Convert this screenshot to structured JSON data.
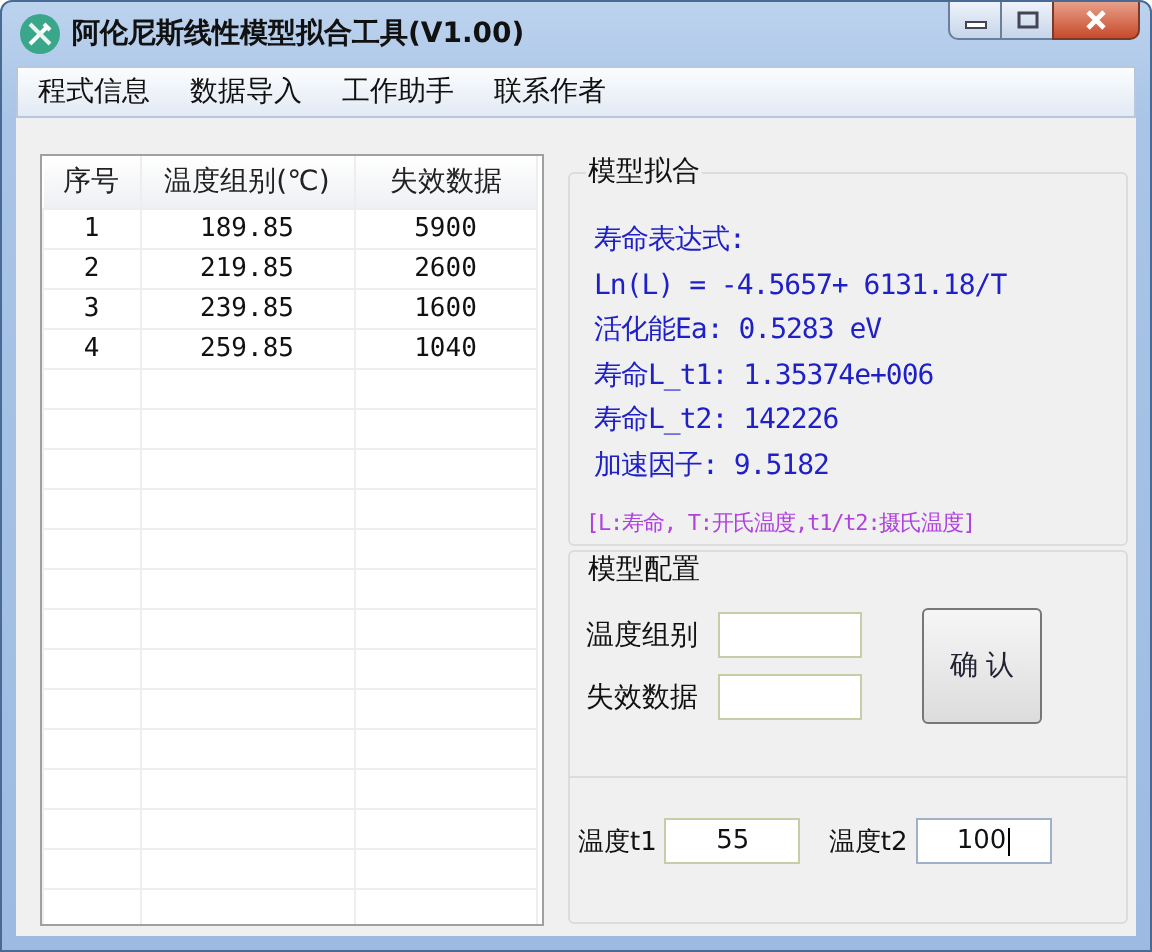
{
  "window": {
    "title": "阿伦尼斯线性模型拟合工具(V1.00)"
  },
  "menu": [
    "程式信息",
    "数据导入",
    "工作助手",
    "联系作者"
  ],
  "table": {
    "columns": [
      "序号",
      "温度组别(℃)",
      "失效数据"
    ],
    "rows": [
      [
        "1",
        "189.85",
        "5900"
      ],
      [
        "2",
        "219.85",
        "2600"
      ],
      [
        "3",
        "239.85",
        "1600"
      ],
      [
        "4",
        "259.85",
        "1040"
      ]
    ]
  },
  "fit": {
    "title": "模型拟合",
    "lines": [
      "寿命表达式:",
      "Ln(L) = -4.5657+ 6131.18/T",
      "活化能Ea: 0.5283 eV",
      "寿命L_t1: 1.35374e+006",
      "寿命L_t2: 142226",
      "加速因子: 9.5182"
    ],
    "note": "[L:寿命, T:开氏温度,t1/t2:摄氏温度]"
  },
  "config": {
    "title": "模型配置",
    "fields": [
      {
        "label": "温度组别"
      },
      {
        "label": "失效数据"
      }
    ],
    "button": "确 认"
  },
  "temps": [
    {
      "label": "温度t1",
      "value": "55",
      "focused": false
    },
    {
      "label": "温度t2",
      "value": "100",
      "focused": true
    }
  ]
}
